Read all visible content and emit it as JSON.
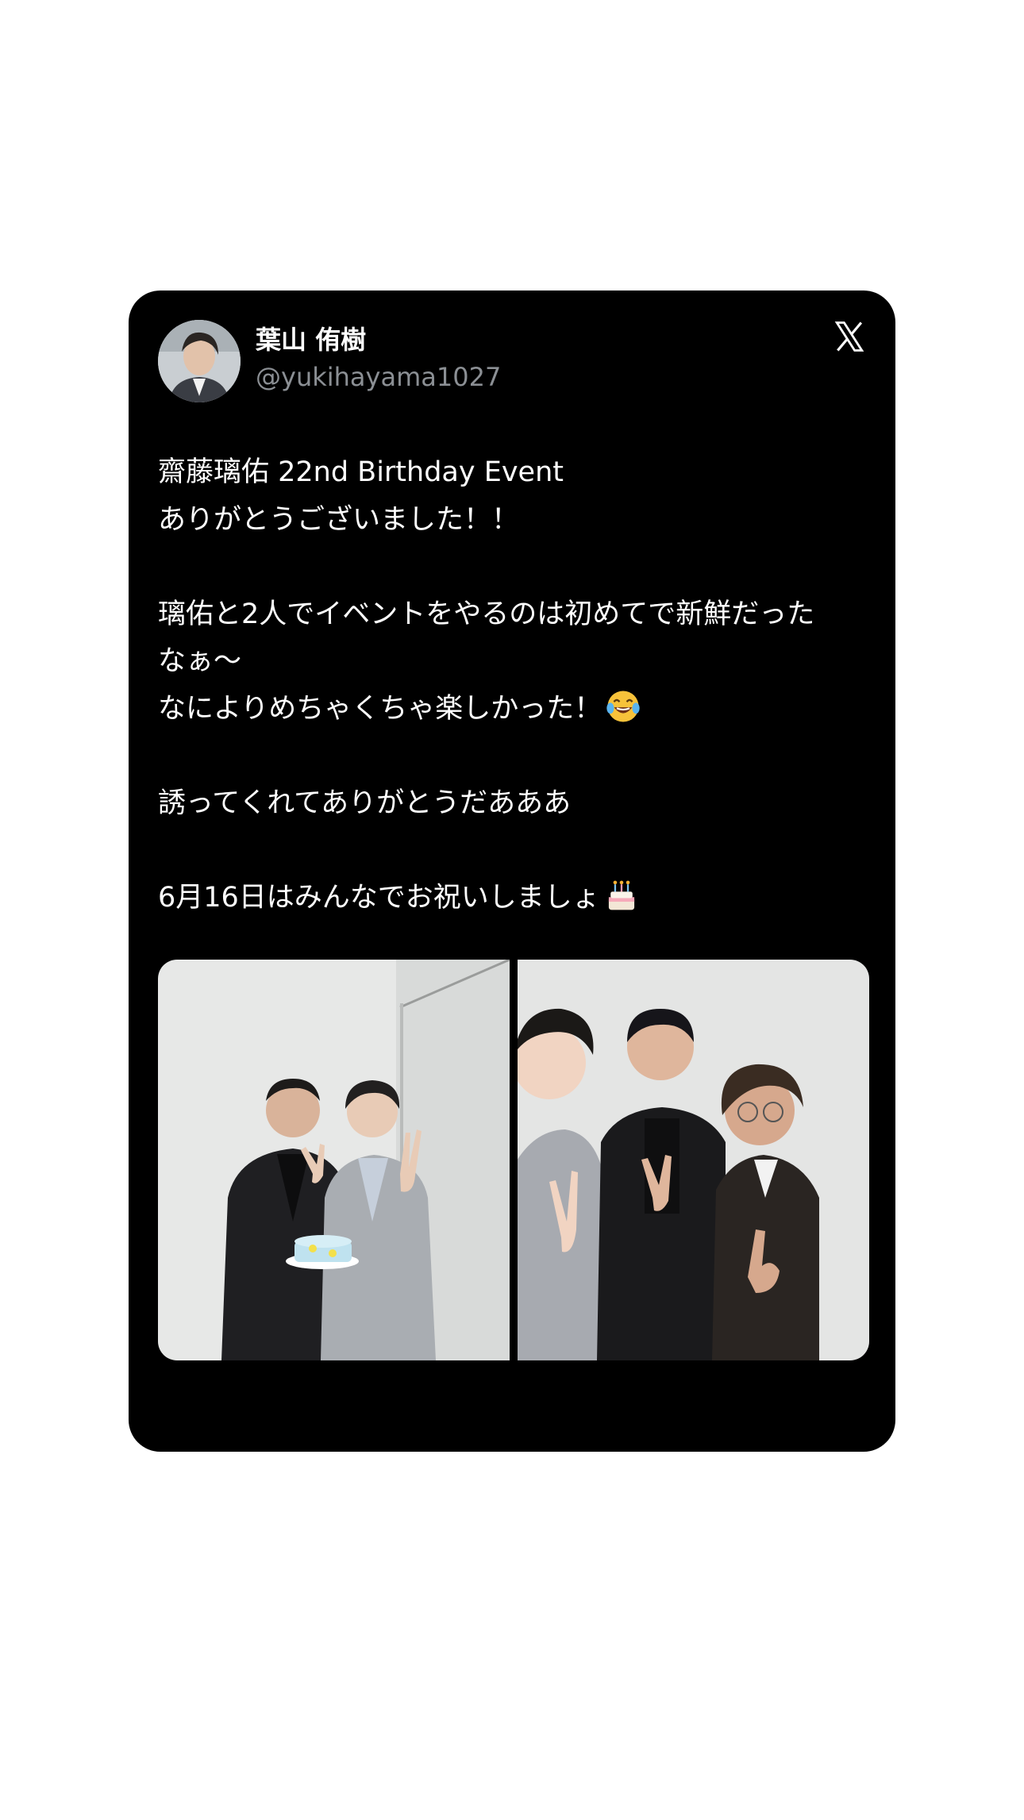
{
  "post": {
    "author_name": "葉山 侑樹",
    "author_handle": "@yukihayama1027",
    "platform_icon": "x-logo-icon",
    "lines": [
      "齋藤璃佑 22nd Birthday Event",
      "ありがとうございました！！",
      "",
      "璃佑と2人でイベントをやるのは初めてで新鮮だった",
      "なぁ〜",
      "なによりめちゃくちゃ楽しかった！",
      "",
      "誘ってくれてありがとうだあああ",
      "",
      "6月16日はみんなでお祝いしましょ"
    ],
    "emojis": {
      "line_5": "laughing-tears-emoji",
      "line_9": "birthday-cake-emoji"
    },
    "photos": [
      {
        "name": "photo-two-men-with-cake",
        "description_icon": "photo"
      },
      {
        "name": "photo-three-men-selfie",
        "description_icon": "photo"
      }
    ]
  },
  "colors": {
    "card_bg": "#000000",
    "page_bg": "#ffffff",
    "text": "#ffffff",
    "handle": "#8b8f94"
  }
}
